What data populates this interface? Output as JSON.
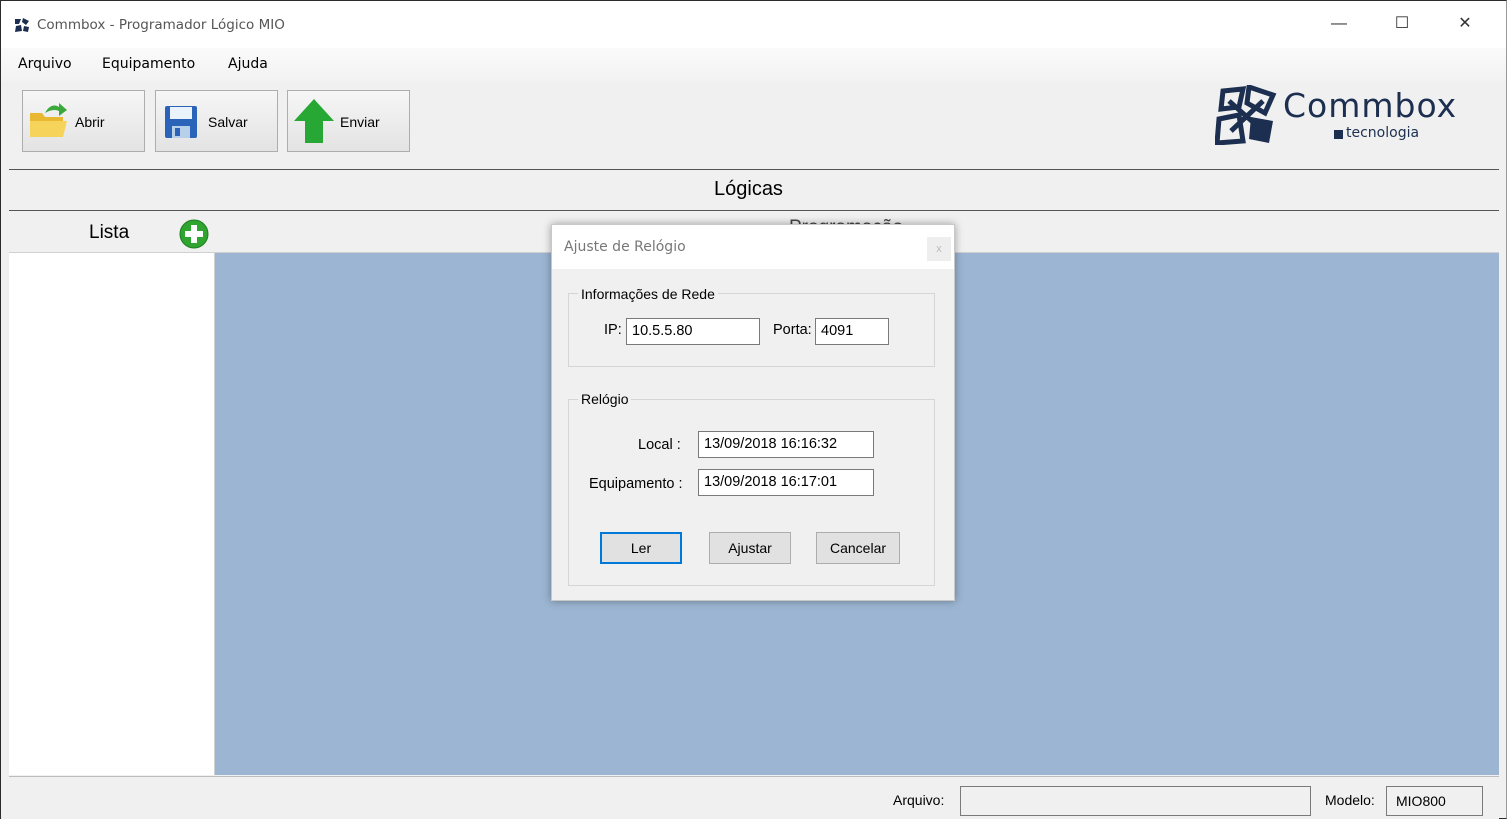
{
  "window": {
    "title": "Commbox - Programador Lógico MIO",
    "minimize": "—",
    "maximize": "☐",
    "close": "✕"
  },
  "menu": {
    "items": [
      "Arquivo",
      "Equipamento",
      "Ajuda"
    ]
  },
  "toolbar": {
    "open_label": "Abrir",
    "save_label": "Salvar",
    "send_label": "Enviar"
  },
  "logo": {
    "word": "Commbox",
    "sub": "tecnologia"
  },
  "section": {
    "title": "Lógicas"
  },
  "subheader": {
    "list_label": "Lista",
    "programming_label": "Programação"
  },
  "status": {
    "file_label": "Arquivo:",
    "file_value": "",
    "model_label": "Modelo:",
    "model_value": "MIO800"
  },
  "dialog": {
    "title": "Ajuste de Relógio",
    "close": "x",
    "network_group": "Informações de Rede",
    "ip_label": "IP:",
    "ip_value": "10.5.5.80",
    "port_label": "Porta:",
    "port_value": "4091",
    "clock_group": "Relógio",
    "local_label": "Local :",
    "local_value": "13/09/2018 16:16:32",
    "device_label": "Equipamento :",
    "device_value": "13/09/2018 16:17:01",
    "read_button": "Ler",
    "adjust_button": "Ajustar",
    "cancel_button": "Cancelar"
  },
  "colors": {
    "main_area": "#9bb5d2",
    "logo": "#1c2f50",
    "accent": "#0078d7",
    "add_icon": "#2fa42f",
    "send_arrow": "#27a834"
  }
}
